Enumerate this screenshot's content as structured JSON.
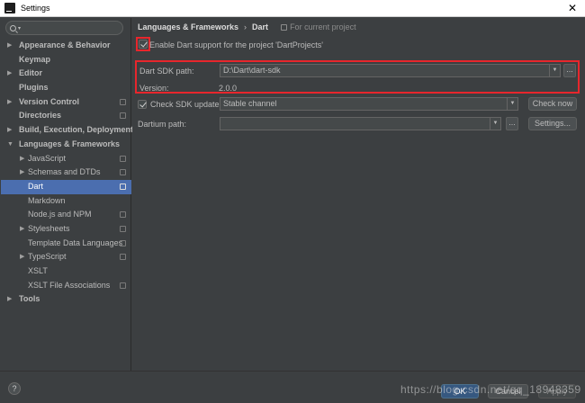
{
  "window": {
    "title": "Settings"
  },
  "search": {
    "placeholder": ""
  },
  "sidebar": {
    "items": [
      {
        "label": "Appearance & Behavior",
        "level": 0,
        "expandable": true,
        "bold": true,
        "project_icon": false
      },
      {
        "label": "Keymap",
        "level": 0,
        "expandable": false,
        "bold": true,
        "project_icon": false
      },
      {
        "label": "Editor",
        "level": 0,
        "expandable": true,
        "bold": true,
        "project_icon": false
      },
      {
        "label": "Plugins",
        "level": 0,
        "expandable": false,
        "bold": true,
        "project_icon": false
      },
      {
        "label": "Version Control",
        "level": 0,
        "expandable": true,
        "bold": true,
        "project_icon": true
      },
      {
        "label": "Directories",
        "level": 0,
        "expandable": false,
        "bold": true,
        "project_icon": true
      },
      {
        "label": "Build, Execution, Deployment",
        "level": 0,
        "expandable": true,
        "bold": true,
        "project_icon": false
      },
      {
        "label": "Languages & Frameworks",
        "level": 0,
        "expandable": true,
        "expanded": true,
        "bold": true,
        "project_icon": false
      },
      {
        "label": "JavaScript",
        "level": 1,
        "expandable": true,
        "bold": false,
        "project_icon": true
      },
      {
        "label": "Schemas and DTDs",
        "level": 1,
        "expandable": true,
        "bold": false,
        "project_icon": true
      },
      {
        "label": "Dart",
        "level": 1,
        "expandable": false,
        "bold": false,
        "project_icon": true,
        "selected": true
      },
      {
        "label": "Markdown",
        "level": 1,
        "expandable": false,
        "bold": false,
        "project_icon": false
      },
      {
        "label": "Node.js and NPM",
        "level": 1,
        "expandable": false,
        "bold": false,
        "project_icon": true
      },
      {
        "label": "Stylesheets",
        "level": 1,
        "expandable": true,
        "bold": false,
        "project_icon": true
      },
      {
        "label": "Template Data Languages",
        "level": 1,
        "expandable": false,
        "bold": false,
        "project_icon": true
      },
      {
        "label": "TypeScript",
        "level": 1,
        "expandable": true,
        "bold": false,
        "project_icon": true
      },
      {
        "label": "XSLT",
        "level": 1,
        "expandable": false,
        "bold": false,
        "project_icon": false
      },
      {
        "label": "XSLT File Associations",
        "level": 1,
        "expandable": false,
        "bold": false,
        "project_icon": true
      },
      {
        "label": "Tools",
        "level": 0,
        "expandable": true,
        "bold": true,
        "project_icon": false
      }
    ]
  },
  "breadcrumb": {
    "items": [
      "Languages & Frameworks",
      "Dart"
    ],
    "separator": "›",
    "scope": "For current project"
  },
  "dart": {
    "enable_label": "Enable Dart support for the project 'DartProjects'",
    "enable_checked": true,
    "sdk_path_label": "Dart SDK path:",
    "sdk_path_value": "D:\\Dart\\dart-sdk",
    "version_label": "Version:",
    "version_value": "2.0.0",
    "check_update_label": "Check SDK update:",
    "check_update_checked": true,
    "channel_value": "Stable channel",
    "check_now_label": "Check now",
    "dartium_label": "Dartium path:",
    "dartium_value": "",
    "settings_label": "Settings...",
    "browse_label": "..."
  },
  "footer": {
    "help_label": "?",
    "ok_label": "OK",
    "cancel_label": "Cancel",
    "apply_label": "Apply",
    "watermark": "https://blog.csdn.net/qq_18948359"
  },
  "colors": {
    "background": "#3c3f41",
    "selection": "#4b6eaf",
    "highlight_box": "#e8262c",
    "ok_button": "#365880"
  }
}
